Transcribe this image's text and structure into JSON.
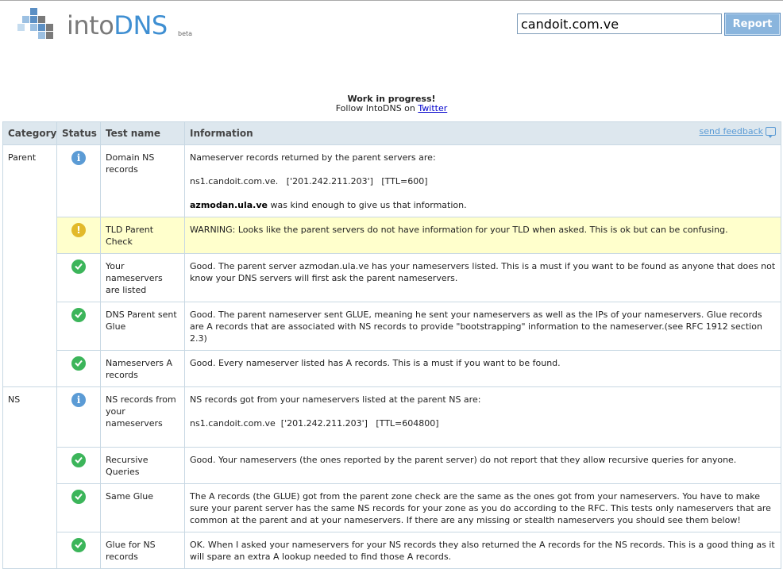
{
  "logo": {
    "into": "into",
    "dns": "DNS",
    "beta": "beta"
  },
  "search": {
    "value": "candoit.com.ve"
  },
  "report_button": "Report",
  "notice": {
    "title": "Work in progress!",
    "follow_text": "Follow IntoDNS on",
    "link": "Twitter"
  },
  "table": {
    "headers": {
      "category": "Category",
      "status": "Status",
      "test": "Test name",
      "info": "Information"
    },
    "feedback": "send feedback",
    "rows": [
      {
        "category": "Parent",
        "status": "info",
        "test": "Domain NS records",
        "info1": "Nameserver records returned by the parent servers are:",
        "info2": "ns1.candoit.com.ve.   ['201.242.211.203']   [TTL=600]",
        "info3_bold": "azmodan.ula.ve",
        "info3": " was kind enough to give us that information."
      },
      {
        "status": "warning",
        "test": "TLD Parent Check",
        "info1": "WARNING: Looks like the parent servers do not have information for your TLD when asked. This is ok but can be confusing."
      },
      {
        "status": "ok",
        "test": "Your nameservers are listed",
        "info1": "Good. The parent server azmodan.ula.ve has your nameservers listed. This is a must if you want to be found as anyone that does not know your DNS servers will first ask the parent nameservers."
      },
      {
        "status": "ok",
        "test": "DNS Parent sent Glue",
        "info1": "Good. The parent nameserver sent GLUE, meaning he sent your nameservers as well as the IPs of your nameservers. Glue records are A records that are associated with NS records to provide \"bootstrapping\" information to the nameserver.(see RFC 1912 section 2.3)"
      },
      {
        "status": "ok",
        "test": "Nameservers A records",
        "info1": "Good. Every nameserver listed has A records. This is a must if you want to be found."
      },
      {
        "category": "NS",
        "status": "info",
        "test": "NS records from your nameservers",
        "info1": "NS records got from your nameservers listed at the parent NS are:",
        "info2": "ns1.candoit.com.ve  ['201.242.211.203']   [TTL=604800]"
      },
      {
        "status": "ok",
        "test": "Recursive Queries",
        "info1": "Good. Your nameservers (the ones reported by the parent server) do not report that they allow recursive queries for anyone."
      },
      {
        "status": "ok",
        "test": "Same Glue",
        "info1": "The A records (the GLUE) got from the parent zone check are the same as the ones got from your nameservers. You have to make sure your parent server has the same NS records for your zone as you do according to the RFC. This tests only nameservers that are common at the parent and at your nameservers. If there are any missing or stealth nameservers you should see them below!"
      },
      {
        "status": "ok",
        "test": "Glue for NS records",
        "info1": "OK. When I asked your nameservers for your NS records they also returned the A records for the NS records. This is a good thing as it will spare an extra A lookup needed to find those A records."
      }
    ]
  },
  "colors": {
    "info": "#5b9bd5",
    "warning": "#e2b92a",
    "ok": "#3cb55a",
    "warn_row": "#ffffcc",
    "header_bg": "#dde7ee"
  }
}
